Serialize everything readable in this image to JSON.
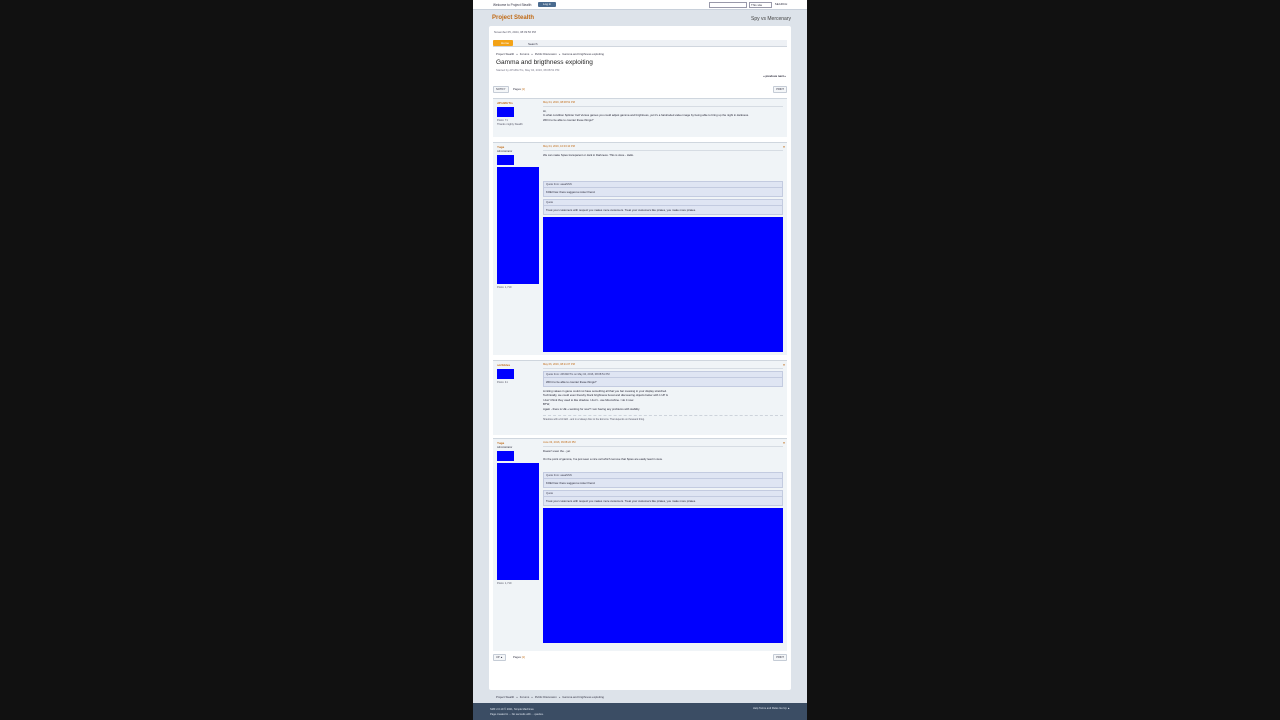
{
  "topbar": {
    "welcome": "Welcome to Project Stealth",
    "logout": "Log in",
    "search_scope": "This site",
    "search_button": "SEARCH"
  },
  "header": {
    "forum_title": "Project Stealth",
    "slogan": "Spy vs Mercenary"
  },
  "date": "November 05, 2024, 08:09:56 PM",
  "nav": {
    "home": "Home",
    "search": "Search"
  },
  "breadcrumb": [
    "Project Stealth",
    "Forums",
    "Public Discussion",
    "Gamma and brigthness exploiting"
  ],
  "topic": {
    "title": "Gamma and brigthness exploiting",
    "meta": "Started by dPrdWcTrs, May 04, 2016, 08:08:51 PM",
    "prevnext": "« previous next »"
  },
  "pagebar": {
    "notify": "NOTIFY",
    "pages_label": "Pages",
    "pages_num": "[1]",
    "print": "PRINT"
  },
  "posts": [
    {
      "name": "dPrdWcTrs",
      "group": "",
      "posts": "Posts: 71",
      "personal": "Thanks mighty Stealth",
      "date": "May 04, 2016, 08:08:51 PM",
      "lines": [
        "Hi,",
        "In what condition Splinter Cell Versus games you could adjust gamma and brightness, yet it's a hardcoded value image by being able to bring up the night in darkness.",
        "Will it to be able to counter these things?"
      ],
      "quotes": []
    },
    {
      "name": "Yuga",
      "group": "Administrator",
      "posts": "Posts: 1,719",
      "personal": "",
      "date": "May 04, 2016, 10:03:10 PM",
      "lines": [
        "We can make Spies transparent or dark in Darkness. This is done - Hello."
      ],
      "quotes": [
        {
          "header": "Quote from: aaaaNNN",
          "text": "KOEI has: there suggest a roster friend."
        },
        {
          "header": "Quote",
          "text": "Treat your customers with respect you makes more customers. Treat your customers like pirates, you make more pirates."
        }
      ]
    },
    {
      "name": "scribbles",
      "group": "",
      "posts": "Posts: 41",
      "personal": "",
      "date": "May 06, 2016, 08:21:07 PM",
      "quote": {
        "header": "Quote from: dPrdWcTrs on May 04, 2016, 08:08:51 PM",
        "text": "Will it to be able to counter these things?"
      },
      "lines": [
        "Limiting values in game could not have something all that you bar messing in your display stretched.",
        "Technically, we could even thereby block brightness boost and discovering objects better with 1 UP &",
        "I don't think they used to like shadow. I don't - use Moonshine. I do it now.",
        "BTW,",
        "Again - there is UE + working for now? I am having any problems with stability."
      ],
      "sig": "Shadows with a bit faith - and in a! always bloc to the Enmons. That depends on thousand thing."
    },
    {
      "name": "Yuga",
      "group": "Administrator",
      "posts": "Posts: 1,719",
      "personal": "",
      "date": "June 03, 2016, 09:08:22 PM",
      "lines": [
        "Doesn't even the - yet",
        "On the point of gamma, I've just seen a nice cell which remove that Spies are easily lead in view."
      ],
      "quotes": [
        {
          "header": "Quote from: aaaaNNN",
          "text": "KOEI has: there suggest a roster friend."
        },
        {
          "header": "Quote",
          "text": "Treat your customers with respect you makes more customers. Treat your customers like pirates, you make more pirates."
        }
      ]
    }
  ],
  "jumpto": {
    "label": "Jump to:",
    "selected": "=> Public Discussion",
    "go": "GO"
  },
  "footer": {
    "line1": "SMF 2.0.19 © 2021, Simple Machines",
    "line2": "Page created in ... No seconds with ... queries.",
    "right": "Help  Terms and Rules  Go Up ▲"
  },
  "colors": {
    "accent": "#c06a15",
    "tab": "#f3a317",
    "footer": "#3b4d64",
    "placeholder_image": "#0000ff"
  }
}
